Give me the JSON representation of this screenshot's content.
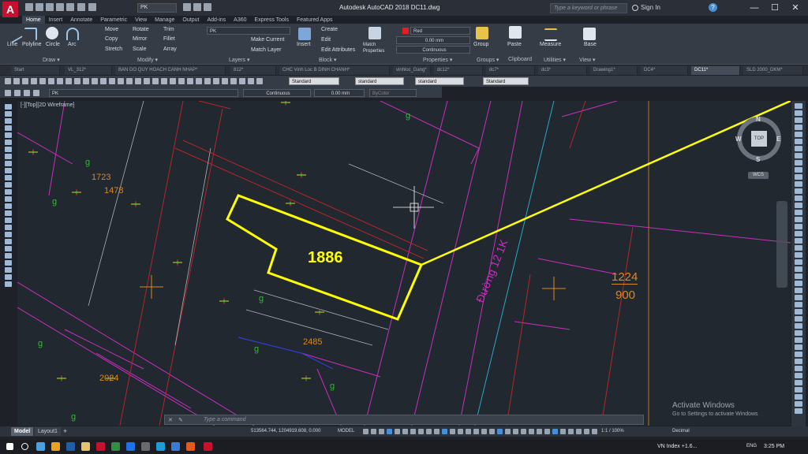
{
  "app": {
    "logo": "A",
    "title": "Autodesk AutoCAD 2018   DC11.dwg",
    "search_placeholder": "Type a keyword or phrase",
    "sign_in": "Sign In"
  },
  "quick_access": {
    "workspace": "PK"
  },
  "window_controls": {
    "minimize": "—",
    "maximize": "☐",
    "close": "✕"
  },
  "ribbon_tabs": [
    "Home",
    "Insert",
    "Annotate",
    "Parametric",
    "View",
    "Manage",
    "Output",
    "Add-ins",
    "A360",
    "Express Tools",
    "Featured Apps"
  ],
  "ribbon": {
    "draw": {
      "line": "Line",
      "polyline": "Polyline",
      "circle": "Circle",
      "arc": "Arc",
      "label": "Draw ▾"
    },
    "modify": {
      "move": "Move",
      "rotate": "Rotate",
      "trim": "Trim",
      "copy": "Copy",
      "mirror": "Mirror",
      "fillet": "Fillet",
      "stretch": "Stretch",
      "scale": "Scale",
      "array": "Array",
      "label": "Modify ▾"
    },
    "layers": {
      "current_layer": "PK",
      "make_current": "Make Current",
      "match_layer": "Match Layer",
      "label": "Layers ▾"
    },
    "block": {
      "insert": "Insert",
      "create": "Create",
      "edit": "Edit",
      "edit_attributes": "Edit Attributes",
      "label": "Block ▾"
    },
    "properties": {
      "match": "Match Properties",
      "color": "Red",
      "lineweight": "0.00 mm",
      "linetype": "Continuous",
      "label": "Properties ▾"
    },
    "groups": {
      "group": "Group",
      "label": "Groups ▾"
    },
    "clipboard": {
      "paste": "Paste",
      "label": "Clipboard"
    },
    "utilities": {
      "measure": "Measure",
      "label": "Utilities ▾"
    },
    "view": {
      "base": "Base",
      "label": "View ▾"
    }
  },
  "doc_tabs": [
    "Start",
    "VL_312*",
    "BAN DO QUY HOACH CANH NHAP*",
    "812*",
    "CHC Vinh Loc B DINH CHANH*",
    "vinhloc_Dang*",
    "dc12*",
    "dc7*",
    "dc3*",
    "Drawing1*",
    "DC4*",
    "DC11*",
    "SLD 2000_DKM*"
  ],
  "active_doc_tab": "DC11*",
  "toolbar": {
    "text_style": "Standard",
    "dim_style": "standard",
    "table_style": "standard",
    "multileader_style": "Standard",
    "layer": "PK",
    "linetype": "Continuous",
    "lineweight": "0.00 mm",
    "plot_style": "ByColor"
  },
  "viewport": {
    "label": "[-][Top][2D Wireframe]"
  },
  "viewcube": {
    "n": "N",
    "s": "S",
    "e": "E",
    "w": "W",
    "top": "TOP",
    "wcs": "WCS"
  },
  "drawing": {
    "parcel_number": "1886",
    "road_label": "Đường 12 1K",
    "right_parcel_top": "1224",
    "right_parcel_bottom": "900",
    "parcel_labels": [
      "1723",
      "1478",
      "2485",
      "2024"
    ],
    "land_code": "g"
  },
  "command": {
    "placeholder": "Type a command"
  },
  "watermark": {
    "title": "Activate Windows",
    "subtitle": "Go to Settings to activate Windows"
  },
  "status": {
    "model_tab": "Model",
    "layout_tab": "Layout1",
    "coords": "513564.744, 1204919.608, 0.000",
    "model": "MODEL",
    "scale": "1:1 / 100%",
    "units": "Decimal"
  },
  "taskbar": {
    "tray_text": "VN Index +1.6...",
    "lang": "ENG",
    "time": "3:25 PM"
  },
  "colors": {
    "parcel_highlight": "#ffff00",
    "boundary_pink": "#c0267b",
    "boundary_red": "#b5262a",
    "road_magenta": "#c72fbe",
    "label_green": "#2fbf2f",
    "label_orange": "#d98a1e"
  }
}
